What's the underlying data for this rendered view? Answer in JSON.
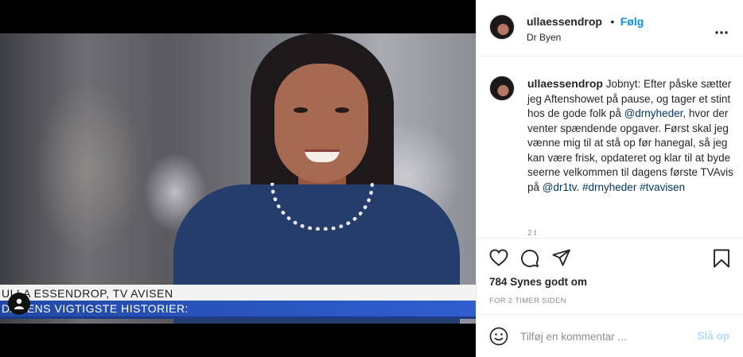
{
  "header": {
    "username": "ullaessendrop",
    "separator": "•",
    "follow_label": "Følg",
    "location": "Dr Byen",
    "more_icon": "more-options-icon"
  },
  "caption": {
    "username": "ullaessendrop",
    "text_1": "Jobnyt: Efter påske sætter jeg Aftenshowet på pause, og tager et stint hos de gode folk på ",
    "mention_1": "@drnyheder",
    "text_2": ", hvor der venter spændende opgaver. Først skal jeg vænne mig til at stå op før hanegal, så jeg kan være frisk, opdateret og klar til at byde seerne velkommen til dagens første TVAvis på ",
    "mention_2": "@dr1tv",
    "text_3": ". ",
    "hashtag_1": "#drnyheder",
    "hashtag_2": "#tvavisen",
    "age": "2 t"
  },
  "media": {
    "lower_third_name": "ULLA ESSENDROP, TV AVISEN",
    "lower_third_headline": "DAGENS VIGTIGSTE HISTORIER:",
    "tag_icon": "user-tag-icon"
  },
  "actions": {
    "icons": [
      "heart-icon",
      "comment-icon",
      "share-icon",
      "bookmark-icon"
    ],
    "likes": "784 Synes godt om",
    "timestamp": "FOR 2 TIMER SIDEN"
  },
  "comment_box": {
    "placeholder": "Tilføj en kommentar ...",
    "post_label": "Slå op",
    "emoji_icon": "emoji-icon"
  },
  "colors": {
    "link": "#00376b",
    "follow": "#0095f6",
    "post_disabled": "#b3dbff",
    "lower_third_blue": "#2249a8"
  }
}
